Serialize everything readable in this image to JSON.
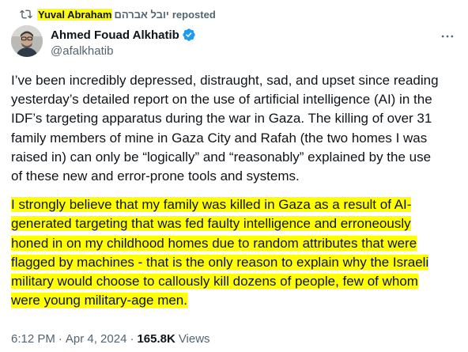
{
  "repost": {
    "icon": "repost-icon",
    "name": "Yuval Abraham",
    "hebrew": "יובל אברהם",
    "suffix": "reposted"
  },
  "author": {
    "avatar": "avatar",
    "display_name": "Ahmed Fouad Alkhatib",
    "verified_icon": "verified-badge-icon",
    "handle": "@afalkhatib"
  },
  "more_icon": "more-options-icon",
  "text": {
    "para1_lines": [
      "I’ve been incredibly depressed, distraught, sad, and upset since reading",
      "yesterday’s detailed report on the use of artificial intelligence (AI) in the",
      "IDF’s targeting apparatus during the war in Gaza. The killing of over 31",
      "family members of mine in Gaza City and Rafah (the two homes I was",
      "raised in) can only be “logically” and “reasonably” explained by the use",
      "of these new and error-prone tools and systems."
    ],
    "para2_lines": [
      "I strongly believe that my family was killed in Gaza as a result of AI-",
      "generated targeting that was fed faulty intelligence and erroneously",
      "honed in on my childhood homes due to random attributes that were",
      "flagged by machines - that is the only reason to explain why the Israeli",
      "military would choose to callously kill dozens of people, few of whom",
      "were young military-age men."
    ]
  },
  "meta": {
    "time": "6:12 PM",
    "separator": "·",
    "date": "Apr 4, 2024",
    "views_count": "165.8K",
    "views_label": "Views"
  },
  "colors": {
    "highlight": "#ffff00",
    "verified": "#1d9bf0",
    "secondary_text": "#536471"
  }
}
